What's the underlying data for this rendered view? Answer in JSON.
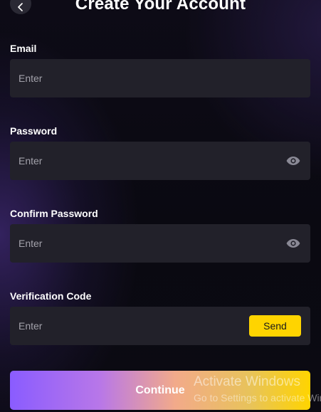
{
  "header": {
    "title": "Create Your Account"
  },
  "form": {
    "email": {
      "label": "Email",
      "placeholder": "Enter",
      "value": ""
    },
    "password": {
      "label": "Password",
      "placeholder": "Enter",
      "value": ""
    },
    "confirm_password": {
      "label": "Confirm Password",
      "placeholder": "Enter",
      "value": ""
    },
    "verification_code": {
      "label": "Verification Code",
      "placeholder": "Enter",
      "value": "",
      "send_label": "Send"
    },
    "continue_label": "Continue"
  },
  "overlay": {
    "activation_title": "Activate Windows",
    "activation_subtitle": "Go to Settings to activate Windows."
  },
  "icons": {
    "back": "chevron-left-icon",
    "show_password": "eye-icon"
  },
  "colors": {
    "accent_yellow": "#ffd400",
    "gradient_start": "#8a5cff",
    "field_background": "#22212a"
  }
}
